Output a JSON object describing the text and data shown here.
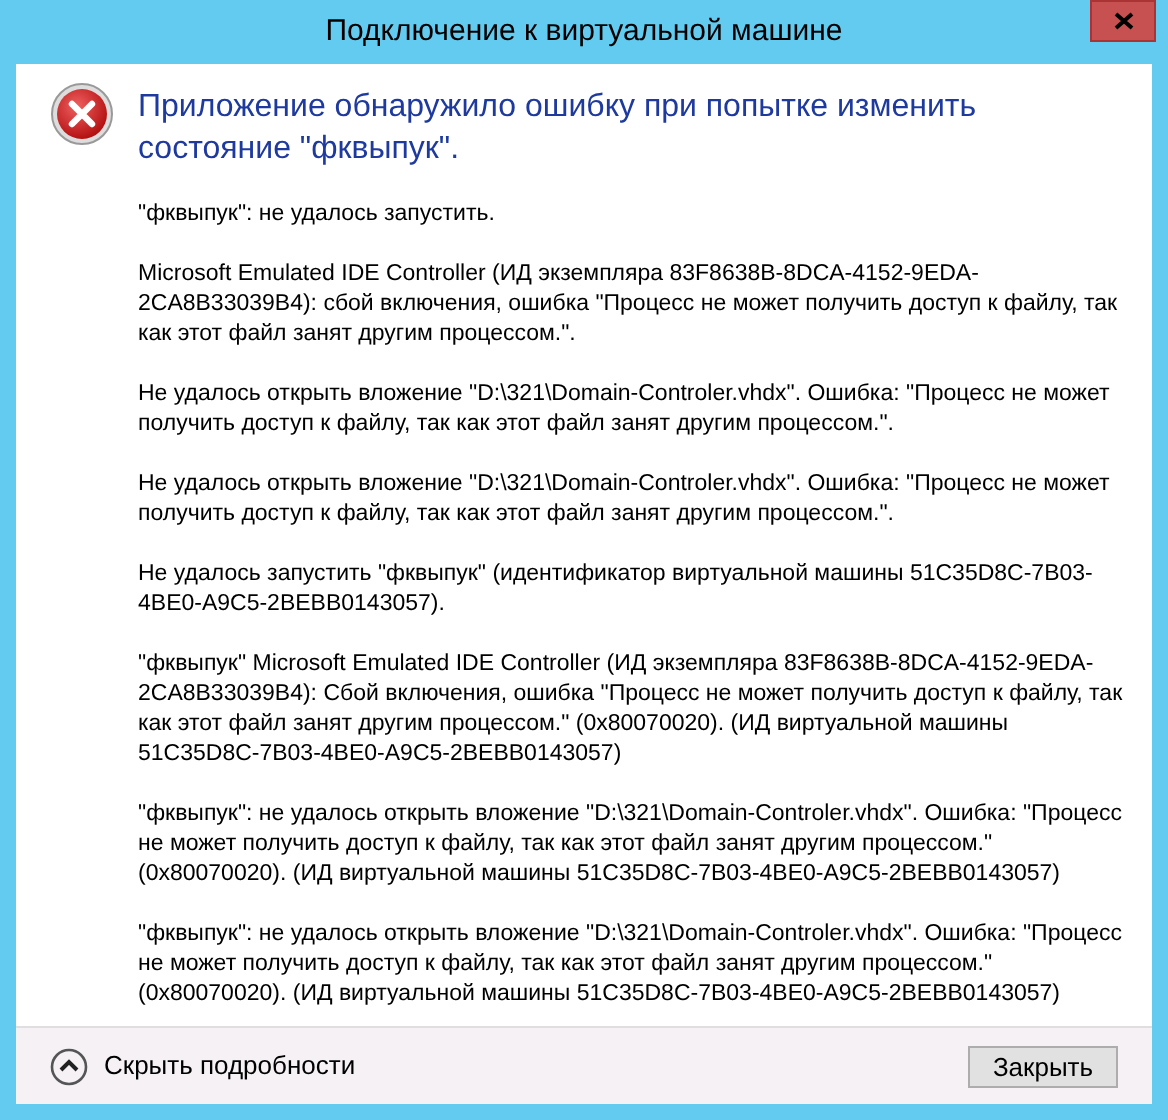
{
  "window": {
    "title": "Подключение к виртуальной машине"
  },
  "heading": "Приложение обнаружило ошибку при попытке изменить состояние \"фквыпук\".",
  "messages": [
    "\"фквыпук\": не удалось запустить.",
    "Microsoft Emulated IDE Controller (ИД экземпляра 83F8638B-8DCA-4152-9EDA-2CA8B33039B4): сбой включения, ошибка \"Процесс не может получить доступ к файлу, так как этот файл занят другим процессом.\".",
    "Не удалось открыть вложение \"D:\\321\\Domain-Controler.vhdx\". Ошибка: \"Процесс не может получить доступ к файлу, так как этот файл занят другим процессом.\".",
    "Не удалось открыть вложение \"D:\\321\\Domain-Controler.vhdx\". Ошибка: \"Процесс не может получить доступ к файлу, так как этот файл занят другим процессом.\".",
    "Не удалось запустить \"фквыпук\" (идентификатор виртуальной машины 51C35D8C-7B03-4BE0-A9C5-2BEBB0143057).",
    "\"фквыпук\" Microsoft Emulated IDE Controller (ИД экземпляра 83F8638B-8DCA-4152-9EDA-2CA8B33039B4): Сбой включения, ошибка \"Процесс не может получить доступ к файлу, так как этот файл занят другим процессом.\" (0x80070020). (ИД виртуальной машины 51C35D8C-7B03-4BE0-A9C5-2BEBB0143057)",
    "\"фквыпук\": не удалось открыть вложение \"D:\\321\\Domain-Controler.vhdx\". Ошибка: \"Процесс не может получить доступ к файлу, так как этот файл занят другим процессом.\" (0x80070020). (ИД виртуальной машины 51C35D8C-7B03-4BE0-A9C5-2BEBB0143057)",
    "\"фквыпук\": не удалось открыть вложение \"D:\\321\\Domain-Controler.vhdx\". Ошибка: \"Процесс не может получить доступ к файлу, так как этот файл занят другим процессом.\" (0x80070020). (ИД виртуальной машины 51C35D8C-7B03-4BE0-A9C5-2BEBB0143057)"
  ],
  "details_toggle": {
    "label": "Скрыть подробности",
    "expanded": true
  },
  "buttons": [
    "Закрыть"
  ]
}
